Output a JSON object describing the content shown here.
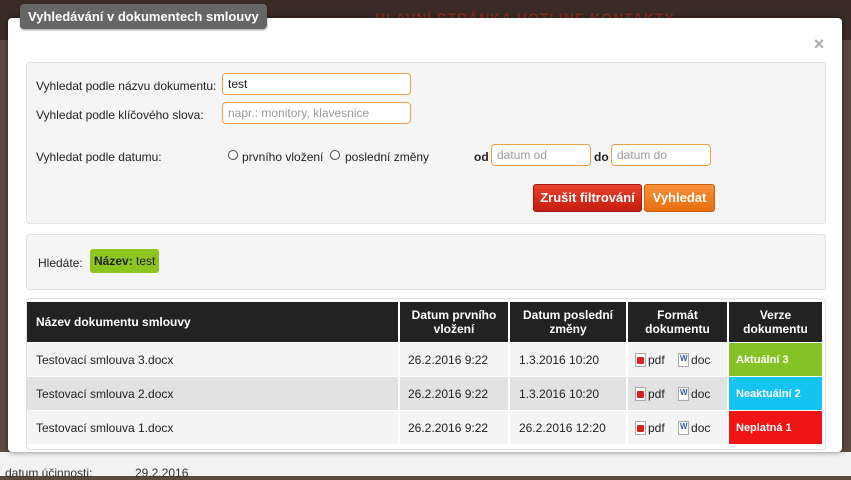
{
  "background": {
    "nav_text": "HLAVNÍ STRÁNKA   HOTLINE   KONTAKTY",
    "bottom_label": "datum účinnosti:",
    "bottom_value": "29.2.2016"
  },
  "modal": {
    "title": "Vyhledávání v dokumentech smlouvy",
    "close_label": "×"
  },
  "filter": {
    "name_label": "Vyhledat podle názvu dokumentu:",
    "name_value": "test",
    "keyword_label": "Vyhledat podle klíčového slova:",
    "keyword_placeholder": "napr.: monitory, klavesnice",
    "date_label": "Vyhledat podle datumu:",
    "radio_first": "prvního vložení",
    "radio_last": "poslední změny",
    "from_label": "od",
    "from_placeholder": "datum od",
    "to_label": "do",
    "to_placeholder": "datum do",
    "cancel_button": "Zrušit filtrování",
    "search_button": "Vyhledat"
  },
  "search": {
    "label": "Hledáte:",
    "tag_key": "Název:",
    "tag_value": " test"
  },
  "table": {
    "headers": {
      "name": "Název dokumentu smlouvy",
      "first": [
        "Datum prvního",
        "vložení"
      ],
      "last": [
        "Datum poslední",
        "změny"
      ],
      "format": [
        "Formát",
        "dokumentu"
      ],
      "version": [
        "Verze",
        "dokumentu"
      ]
    },
    "rows": [
      {
        "name": "Testovací smlouva 3.docx",
        "first": "26.2.2016 9:22",
        "last": "1.3.2016 10:20",
        "pdf": "pdf",
        "doc": "doc",
        "version": "Aktuální 3",
        "version_color": "#84c225"
      },
      {
        "name": "Testovací smlouva 2.docx",
        "first": "26.2.2016 9:22",
        "last": "1.3.2016 10:20",
        "pdf": "pdf",
        "doc": "doc",
        "version": "Neaktuální 2",
        "version_color": "#14c4f0"
      },
      {
        "name": "Testovací smlouva 1.docx",
        "first": "26.2.2016 9:22",
        "last": "26.2.2016 12:20",
        "pdf": "pdf",
        "doc": "doc",
        "version": "Neplatná 1",
        "version_color": "#f01414"
      }
    ]
  }
}
